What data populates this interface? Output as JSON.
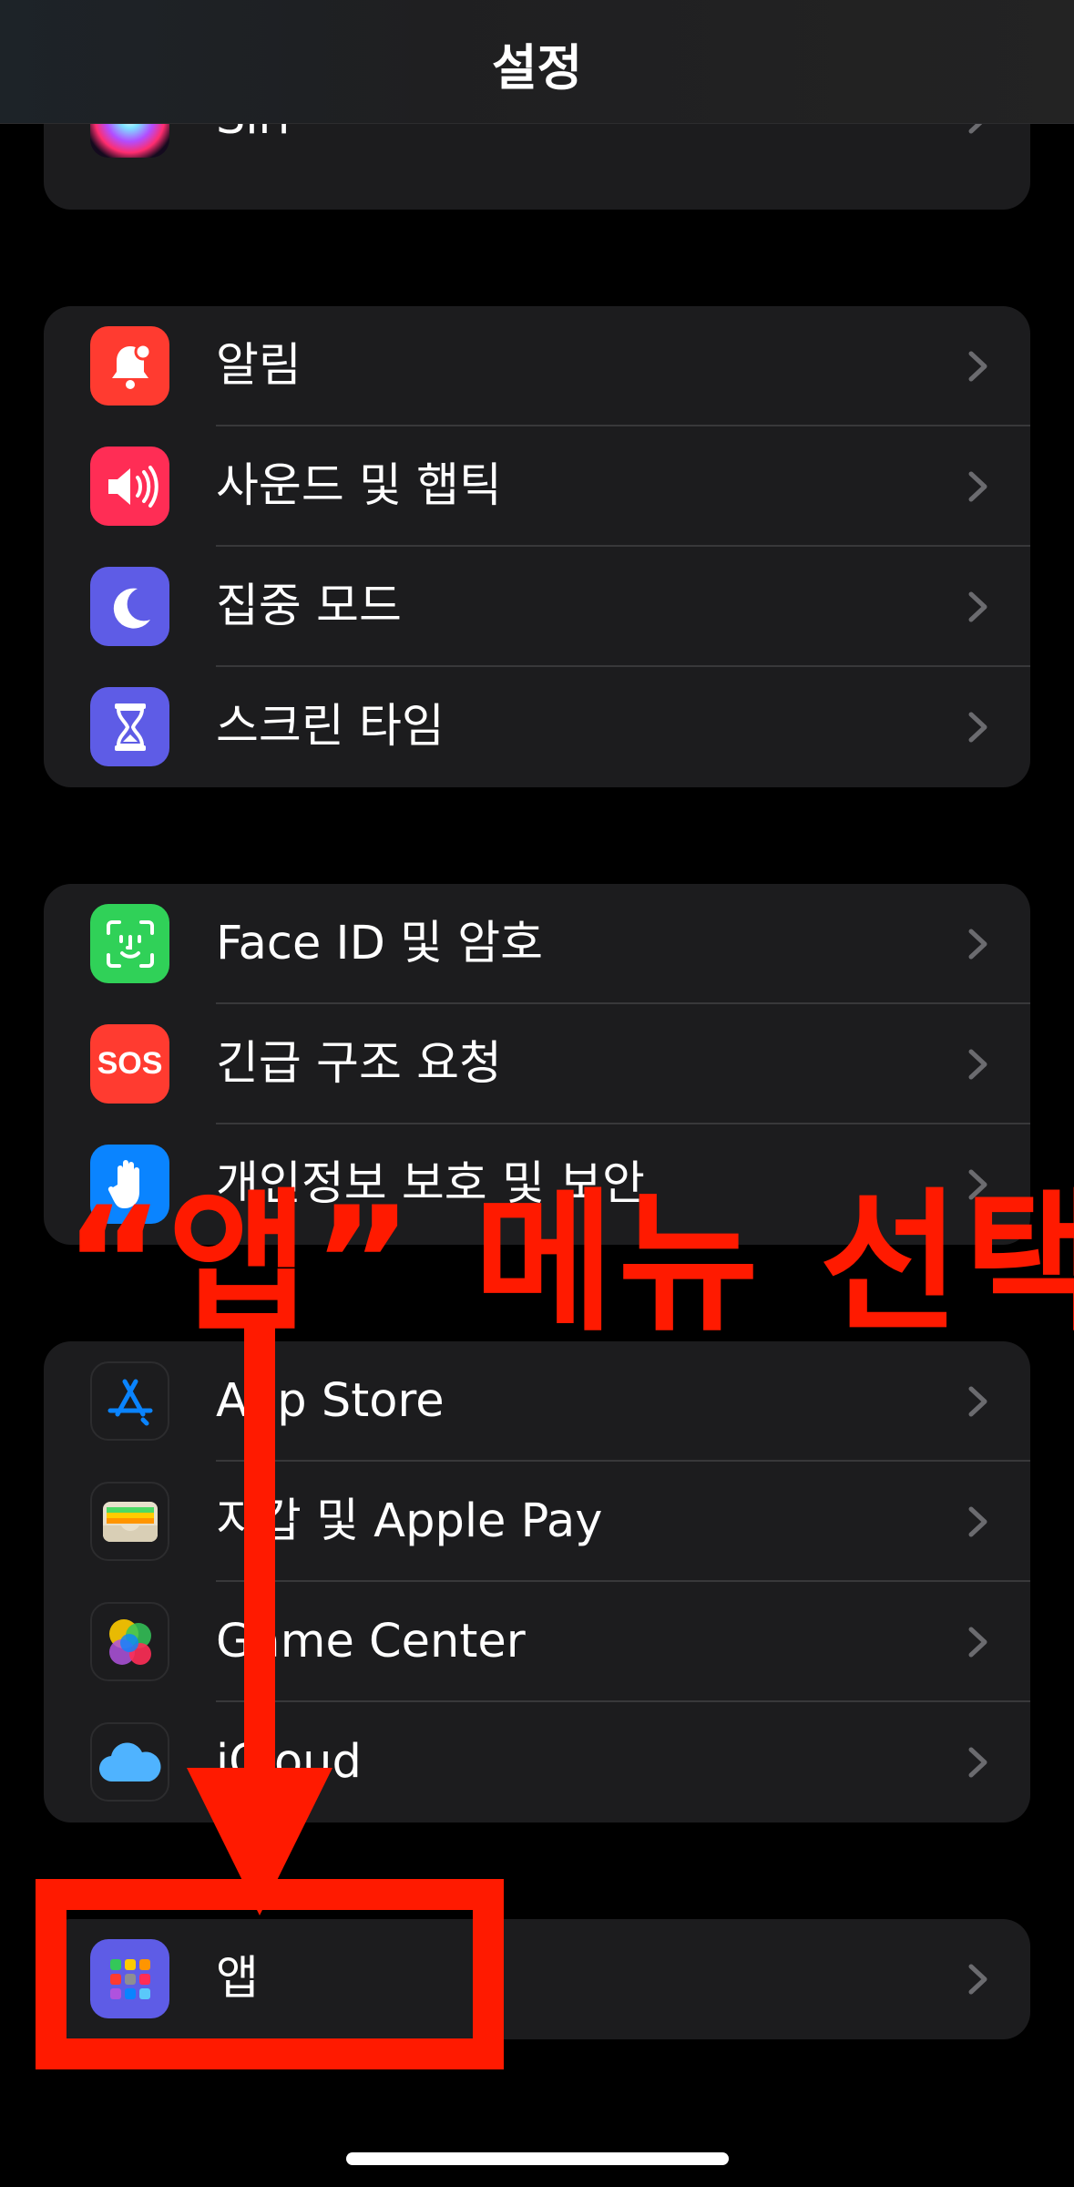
{
  "nav": {
    "title": "설정"
  },
  "groups": [
    {
      "items": [
        {
          "label": "Siri",
          "icon": "siri-icon"
        }
      ]
    },
    {
      "items": [
        {
          "label": "알림",
          "icon": "bell-icon",
          "color": "#ff3b30"
        },
        {
          "label": "사운드 및 햅틱",
          "icon": "speaker-icon",
          "color": "#ff2d55"
        },
        {
          "label": "집중 모드",
          "icon": "moon-icon",
          "color": "#5e5ce6"
        },
        {
          "label": "스크린 타임",
          "icon": "hourglass-icon",
          "color": "#5e5ce6"
        }
      ]
    },
    {
      "items": [
        {
          "label": "Face ID 및 암호",
          "icon": "face-id-icon",
          "color": "#30d158"
        },
        {
          "label": "긴급 구조 요청",
          "icon": "sos-icon",
          "icon_text": "SOS",
          "color": "#ff3b30"
        },
        {
          "label": "개인정보 보호 및 보안",
          "icon": "hand-icon",
          "color": "#0a84ff"
        }
      ]
    },
    {
      "items": [
        {
          "label": "App Store",
          "icon": "app-store-icon",
          "color": "#1c1c1e"
        },
        {
          "label": "지갑 및 Apple Pay",
          "icon": "wallet-icon",
          "color": "#1c1c1e"
        },
        {
          "label": "Game Center",
          "icon": "game-center-icon",
          "color": "#1c1c1e"
        },
        {
          "label": "iCloud",
          "icon": "icloud-icon",
          "color": "#1c1c1e"
        }
      ]
    },
    {
      "items": [
        {
          "label": "앱",
          "icon": "apps-grid-icon",
          "color": "#5e5ce6"
        }
      ]
    }
  ],
  "annotation": {
    "text": "“앱” 메뉴 선택",
    "color": "#ff1a00"
  }
}
